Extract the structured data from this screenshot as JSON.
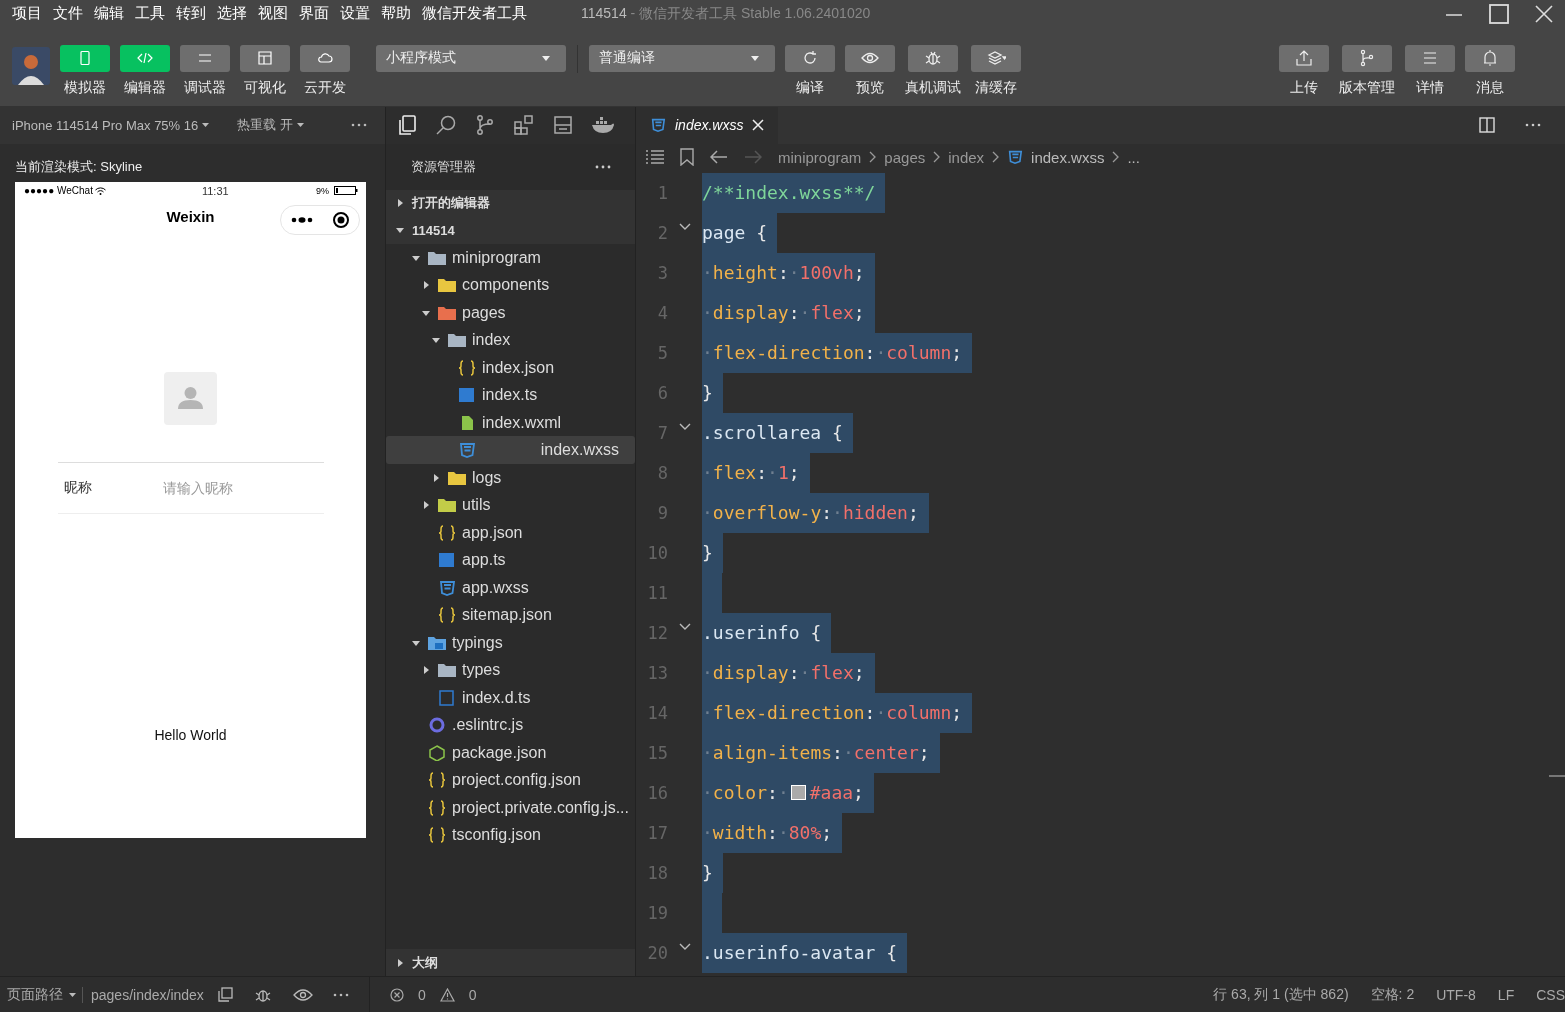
{
  "menu": [
    "项目",
    "文件",
    "编辑",
    "工具",
    "转到",
    "选择",
    "视图",
    "界面",
    "设置",
    "帮助",
    "微信开发者工具"
  ],
  "window": {
    "title": "114514",
    "separator": "-",
    "subtitle": "微信开发者工具 Stable 1.06.2401020"
  },
  "toolbar": {
    "left": [
      {
        "label": "模拟器",
        "kind": "phone",
        "active": true
      },
      {
        "label": "编辑器",
        "kind": "code",
        "active": true
      },
      {
        "label": "调试器",
        "kind": "sliders",
        "active": false
      },
      {
        "label": "可视化",
        "kind": "layout",
        "active": false
      },
      {
        "label": "云开发",
        "kind": "cloud",
        "active": false
      }
    ],
    "mode": "小程序模式",
    "compile": "普通编译",
    "middle": [
      {
        "label": "编译",
        "kind": "refresh"
      },
      {
        "label": "预览",
        "kind": "eye"
      },
      {
        "label": "真机调试",
        "kind": "bug"
      },
      {
        "label": "清缓存",
        "kind": "layers"
      }
    ],
    "right": [
      {
        "label": "上传",
        "kind": "upload"
      },
      {
        "label": "版本管理",
        "kind": "branch"
      },
      {
        "label": "详情",
        "kind": "lines"
      },
      {
        "label": "消息",
        "kind": "bell"
      }
    ]
  },
  "simulator": {
    "device": "iPhone 114514 Pro Max 75% 16",
    "hot_reload": "热重载 开",
    "render_mode": "当前渲染模式: Skyline",
    "phone": {
      "carrier": "●●●●● WeChat",
      "time": "11:31",
      "battery": "9%",
      "title": "Weixin",
      "nickname_label": "昵称",
      "nickname_placeholder": "请输入昵称",
      "greeting": "Hello World"
    }
  },
  "explorer": {
    "title": "资源管理器",
    "sections": [
      {
        "label": "打开的编辑器",
        "expanded": false
      },
      {
        "label": "114514",
        "expanded": true
      }
    ],
    "tree": [
      {
        "name": "miniprogram",
        "kind": "folder",
        "expanded": true,
        "selected": false,
        "children": [
          {
            "name": "components",
            "kind": "folder-yellow",
            "expanded": false,
            "selected": false
          },
          {
            "name": "pages",
            "kind": "folder-red",
            "expanded": true,
            "selected": false,
            "children": [
              {
                "name": "index",
                "kind": "folder",
                "expanded": true,
                "selected": false,
                "children": [
                  {
                    "name": "index.json",
                    "kind": "json",
                    "selected": false
                  },
                  {
                    "name": "index.ts",
                    "kind": "ts",
                    "selected": false
                  },
                  {
                    "name": "index.wxml",
                    "kind": "wxml",
                    "selected": false
                  },
                  {
                    "name": "index.wxss",
                    "kind": "wxss",
                    "selected": true
                  }
                ]
              },
              {
                "name": "logs",
                "kind": "folder-yellow",
                "expanded": false,
                "selected": false
              }
            ]
          },
          {
            "name": "utils",
            "kind": "folder-green",
            "expanded": false,
            "selected": false
          },
          {
            "name": "app.json",
            "kind": "json",
            "selected": false
          },
          {
            "name": "app.ts",
            "kind": "ts",
            "selected": false
          },
          {
            "name": "app.wxss",
            "kind": "wxss",
            "selected": false
          },
          {
            "name": "sitemap.json",
            "kind": "json",
            "selected": false
          }
        ]
      },
      {
        "name": "typings",
        "kind": "folder-ts",
        "expanded": true,
        "selected": false,
        "children": [
          {
            "name": "types",
            "kind": "folder",
            "expanded": false,
            "selected": false
          },
          {
            "name": "index.d.ts",
            "kind": "dts",
            "selected": false
          }
        ]
      },
      {
        "name": ".eslintrc.js",
        "kind": "eslint",
        "selected": false
      },
      {
        "name": "package.json",
        "kind": "npm",
        "selected": false
      },
      {
        "name": "project.config.json",
        "kind": "json",
        "selected": false
      },
      {
        "name": "project.private.config.js...",
        "kind": "json",
        "selected": false
      },
      {
        "name": "tsconfig.json",
        "kind": "json",
        "selected": false
      }
    ],
    "outline": "大纲"
  },
  "editor": {
    "tab": "index.wxss",
    "breadcrumb": [
      "miniprogram",
      "pages",
      "index",
      "index.wxss",
      "..."
    ],
    "lines": [
      {
        "n": "1",
        "fold": false,
        "tokens": [
          {
            "kind": "comment",
            "t": "/**index.wxss**/"
          }
        ]
      },
      {
        "n": "2",
        "fold": true,
        "tokens": [
          {
            "kind": "sel",
            "t": "page"
          },
          {
            "kind": "punct",
            "t": " {"
          }
        ]
      },
      {
        "n": "3",
        "fold": false,
        "tokens": [
          {
            "kind": "ws",
            "t": "·"
          },
          {
            "kind": "prop",
            "t": "height"
          },
          {
            "kind": "punct",
            "t": ":"
          },
          {
            "kind": "ws",
            "t": "·"
          },
          {
            "kind": "val",
            "t": "100vh"
          },
          {
            "kind": "punct",
            "t": ";"
          }
        ]
      },
      {
        "n": "4",
        "fold": false,
        "tokens": [
          {
            "kind": "ws",
            "t": "·"
          },
          {
            "kind": "prop",
            "t": "display"
          },
          {
            "kind": "punct",
            "t": ":"
          },
          {
            "kind": "ws",
            "t": "·"
          },
          {
            "kind": "val",
            "t": "flex"
          },
          {
            "kind": "punct",
            "t": ";"
          }
        ]
      },
      {
        "n": "5",
        "fold": false,
        "tokens": [
          {
            "kind": "ws",
            "t": "·"
          },
          {
            "kind": "prop",
            "t": "flex-direction"
          },
          {
            "kind": "punct",
            "t": ":"
          },
          {
            "kind": "ws",
            "t": "·"
          },
          {
            "kind": "val",
            "t": "column"
          },
          {
            "kind": "punct",
            "t": ";"
          }
        ]
      },
      {
        "n": "6",
        "fold": false,
        "tokens": [
          {
            "kind": "punct",
            "t": "}"
          }
        ]
      },
      {
        "n": "7",
        "fold": true,
        "tokens": [
          {
            "kind": "sel",
            "t": ".scrollarea"
          },
          {
            "kind": "punct",
            "t": " {"
          }
        ]
      },
      {
        "n": "8",
        "fold": false,
        "tokens": [
          {
            "kind": "ws",
            "t": "·"
          },
          {
            "kind": "prop",
            "t": "flex"
          },
          {
            "kind": "punct",
            "t": ":"
          },
          {
            "kind": "ws",
            "t": "·"
          },
          {
            "kind": "val",
            "t": "1"
          },
          {
            "kind": "punct",
            "t": ";"
          }
        ]
      },
      {
        "n": "9",
        "fold": false,
        "tokens": [
          {
            "kind": "ws",
            "t": "·"
          },
          {
            "kind": "prop",
            "t": "overflow-y"
          },
          {
            "kind": "punct",
            "t": ":"
          },
          {
            "kind": "ws",
            "t": "·"
          },
          {
            "kind": "val",
            "t": "hidden"
          },
          {
            "kind": "punct",
            "t": ";"
          }
        ]
      },
      {
        "n": "10",
        "fold": false,
        "tokens": [
          {
            "kind": "punct",
            "t": "}"
          }
        ]
      },
      {
        "n": "11",
        "fold": false
      },
      {
        "n": "12",
        "fold": true,
        "tokens": [
          {
            "kind": "sel",
            "t": ".userinfo"
          },
          {
            "kind": "punct",
            "t": " {"
          }
        ]
      },
      {
        "n": "13",
        "fold": false,
        "tokens": [
          {
            "kind": "ws",
            "t": "·"
          },
          {
            "kind": "prop",
            "t": "display"
          },
          {
            "kind": "punct",
            "t": ":"
          },
          {
            "kind": "ws",
            "t": "·"
          },
          {
            "kind": "val",
            "t": "flex"
          },
          {
            "kind": "punct",
            "t": ";"
          }
        ]
      },
      {
        "n": "14",
        "fold": false,
        "tokens": [
          {
            "kind": "ws",
            "t": "·"
          },
          {
            "kind": "prop",
            "t": "flex-direction"
          },
          {
            "kind": "punct",
            "t": ":"
          },
          {
            "kind": "ws",
            "t": "·"
          },
          {
            "kind": "val",
            "t": "column"
          },
          {
            "kind": "punct",
            "t": ";"
          }
        ]
      },
      {
        "n": "15",
        "fold": false,
        "tokens": [
          {
            "kind": "ws",
            "t": "·"
          },
          {
            "kind": "prop",
            "t": "align-items"
          },
          {
            "kind": "punct",
            "t": ":"
          },
          {
            "kind": "ws",
            "t": "·"
          },
          {
            "kind": "val",
            "t": "center"
          },
          {
            "kind": "punct",
            "t": ";"
          }
        ]
      },
      {
        "n": "16",
        "fold": false,
        "tokens": [
          {
            "kind": "ws",
            "t": "·"
          },
          {
            "kind": "prop",
            "t": "color"
          },
          {
            "kind": "punct",
            "t": ":"
          },
          {
            "kind": "ws",
            "t": "·"
          },
          {
            "kind": "swatch",
            "color": "#aaaaaa"
          },
          {
            "kind": "val",
            "t": "#aaa"
          },
          {
            "kind": "punct",
            "t": ";"
          }
        ]
      },
      {
        "n": "17",
        "fold": false,
        "tokens": [
          {
            "kind": "ws",
            "t": "·"
          },
          {
            "kind": "prop",
            "t": "width"
          },
          {
            "kind": "punct",
            "t": ":"
          },
          {
            "kind": "ws",
            "t": "·"
          },
          {
            "kind": "val",
            "t": "80%"
          },
          {
            "kind": "punct",
            "t": ";"
          }
        ]
      },
      {
        "n": "18",
        "fold": false,
        "tokens": [
          {
            "kind": "punct",
            "t": "}"
          }
        ]
      },
      {
        "n": "19",
        "fold": false
      },
      {
        "n": "20",
        "fold": true,
        "tokens": [
          {
            "kind": "sel",
            "t": ".userinfo-avatar"
          },
          {
            "kind": "punct",
            "t": " {"
          }
        ]
      }
    ]
  },
  "status": {
    "path_label": "页面路径",
    "path": "pages/index/index",
    "errors": "0",
    "warnings": "0",
    "position": "行 63, 列 1 (选中 862)",
    "spaces": "空格: 2",
    "encoding": "UTF-8",
    "eol": "LF",
    "language": "CSS"
  }
}
